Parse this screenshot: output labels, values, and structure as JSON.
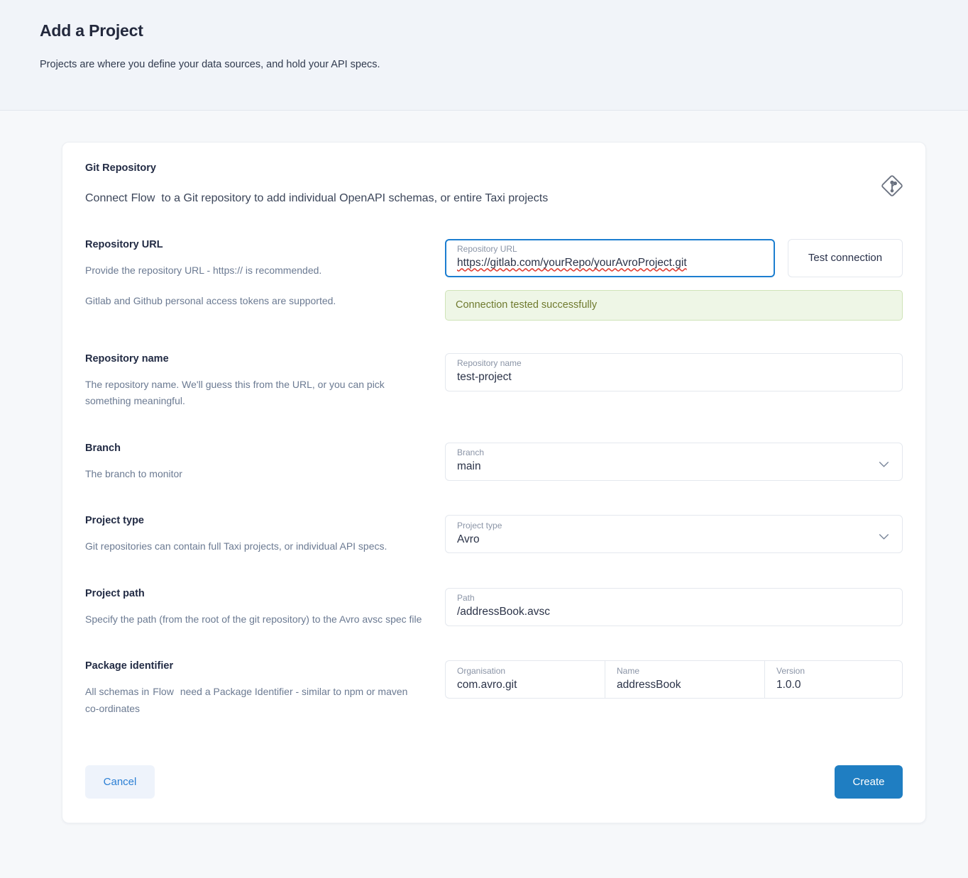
{
  "header": {
    "title": "Add a Project",
    "subtitle": "Projects are where you define your data sources, and hold your API specs."
  },
  "card": {
    "heading": "Git Repository",
    "description_before": "Connect",
    "description_brand": "Flow",
    "description_after": "to a Git repository to add individual OpenAPI schemas, or entire Taxi projects",
    "icon": "git-icon"
  },
  "repository_url": {
    "label": "Repository URL",
    "help_1": "Provide the repository URL - https:// is recommended.",
    "help_2": "Gitlab and Github personal access tokens are supported.",
    "field_label": "Repository URL",
    "value": "https://gitlab.com/yourRepo/yourAvroProject.git",
    "test_button": "Test connection",
    "alert": "Connection tested successfully"
  },
  "repository_name": {
    "label": "Repository name",
    "help": "The repository name. We'll guess this from the URL, or you can pick something meaningful.",
    "field_label": "Repository name",
    "value": "test-project"
  },
  "branch": {
    "label": "Branch",
    "help": "The branch to monitor",
    "field_label": "Branch",
    "value": "main",
    "chevron": "chevron-down-icon"
  },
  "project_type": {
    "label": "Project type",
    "help": "Git repositories can contain full Taxi projects, or individual API specs.",
    "field_label": "Project type",
    "value": "Avro",
    "chevron": "chevron-down-icon"
  },
  "project_path": {
    "label": "Project path",
    "help": "Specify the path (from the root of the git repository) to the Avro avsc spec file",
    "field_label": "Path",
    "value": "/addressBook.avsc"
  },
  "package_identifier": {
    "label": "Package identifier",
    "help_before": "All schemas in",
    "help_brand": "Flow",
    "help_after": "need a Package Identifier - similar to npm or maven co-ordinates",
    "organisation_label": "Organisation",
    "organisation_value": "com.avro.git",
    "name_label": "Name",
    "name_value": "addressBook",
    "version_label": "Version",
    "version_value": "1.0.0"
  },
  "footer": {
    "cancel_label": "Cancel",
    "create_label": "Create"
  },
  "colors": {
    "page_background": "#f6f8fa",
    "header_background": "#f1f4f9",
    "card_background": "#ffffff",
    "primary": "#1f7ec2",
    "focus_border": "#1c7ed0",
    "success_background": "#eef6e6",
    "success_border": "#cfe3b8",
    "success_text": "#6f7a2e",
    "title_text": "#23293d",
    "help_text": "#6b7a92"
  }
}
